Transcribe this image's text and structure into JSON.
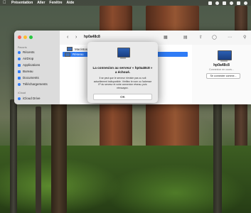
{
  "menubar": {
    "items": [
      "Présentation",
      "Aller",
      "Fenêtre",
      "Aide"
    ]
  },
  "finder": {
    "window_title": "hp0a48c8",
    "sidebar": {
      "favorites_header": "Favoris",
      "favorites": [
        "Récents",
        "AirDrop",
        "Applications",
        "Bureau",
        "Documents",
        "Téléchargements"
      ],
      "locations_header": "iCloud",
      "locations": [
        "iCloud Drive"
      ]
    },
    "list": {
      "rows": [
        "Macintosh...",
        "Réseau"
      ]
    },
    "preview": {
      "name": "hp0a48c8",
      "status": "Connexion en cours...",
      "connect_button": "Se connecter comme..."
    }
  },
  "alert": {
    "title": "La connexion au serveur « hp0a48c8 » a échoué.",
    "message": "Il se peut que le serveur n'existe pas ou soit actuellement indisponible. Vérifiez le nom ou l'adresse IP du serveur et votre connexion réseau, puis réessayez.",
    "ok_label": "OK"
  },
  "colors": {
    "accent": "#2f7cf6",
    "close": "#fe5f57",
    "minimize": "#febc2e",
    "zoom": "#28c840"
  }
}
